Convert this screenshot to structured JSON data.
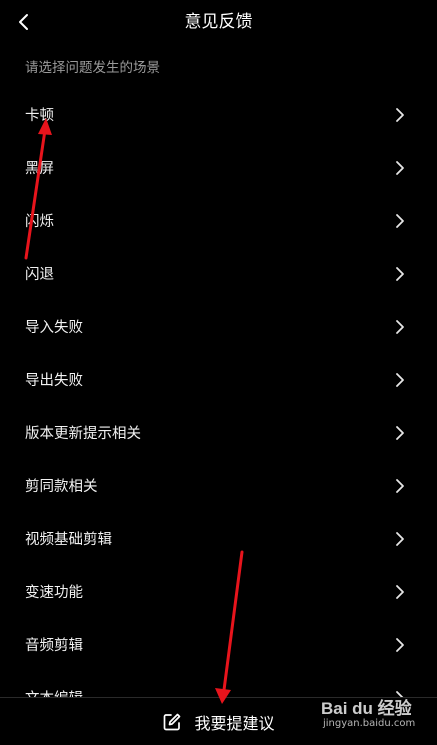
{
  "header": {
    "title": "意见反馈",
    "back_icon": "chevron-left-icon"
  },
  "subtitle": "请选择问题发生的场景",
  "items": [
    {
      "label": "卡顿"
    },
    {
      "label": "黑屏"
    },
    {
      "label": "闪烁"
    },
    {
      "label": "闪退"
    },
    {
      "label": "导入失败"
    },
    {
      "label": "导出失败"
    },
    {
      "label": "版本更新提示相关"
    },
    {
      "label": "剪同款相关"
    },
    {
      "label": "视频基础剪辑"
    },
    {
      "label": "变速功能"
    },
    {
      "label": "音频剪辑"
    },
    {
      "label": "文本编辑"
    }
  ],
  "bottom": {
    "suggest_label": "我要提建议",
    "icon": "edit-icon"
  },
  "watermark": {
    "brand": "Bai du 经验",
    "site": "jingyan.baidu.com"
  },
  "colors": {
    "background": "#000000",
    "text": "#ffffff",
    "subtitle": "#9a9a9a",
    "annotation_arrow": "#e8141c"
  }
}
